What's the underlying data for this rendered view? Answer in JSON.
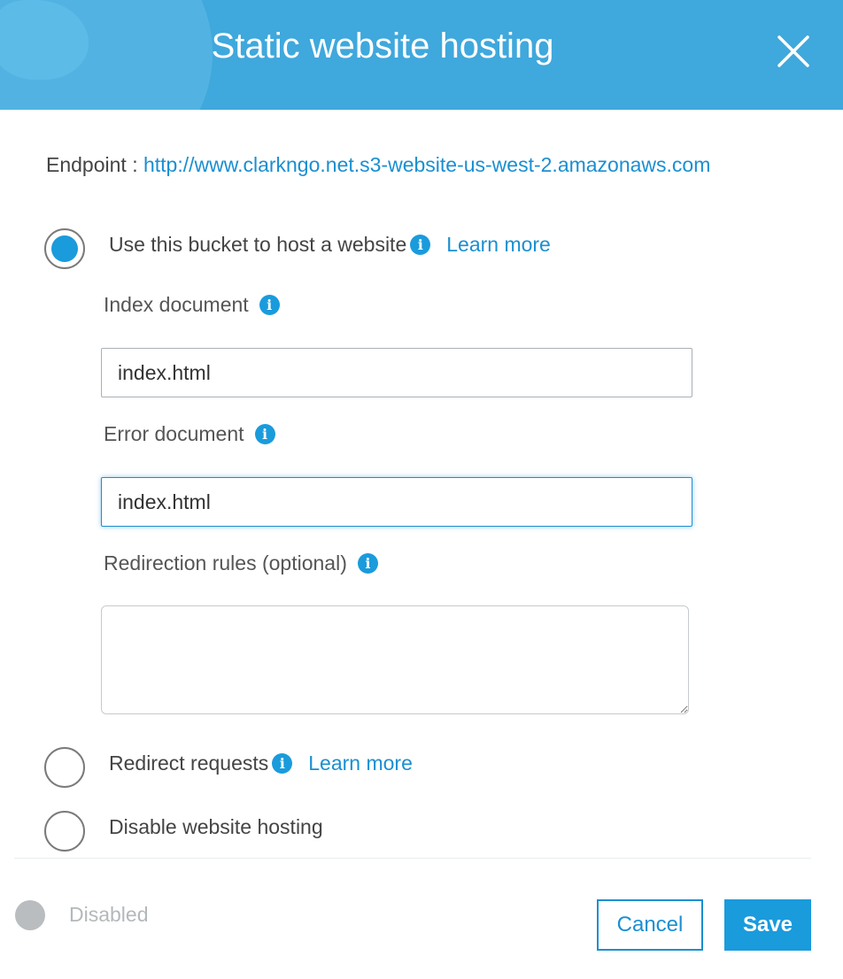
{
  "dialog": {
    "title": "Static website hosting",
    "close_icon": "close-icon"
  },
  "endpoint": {
    "label": "Endpoint : ",
    "url": "http://www.clarkngo.net.s3-website-us-west-2.amazonaws.com"
  },
  "options": {
    "host_website": {
      "label": "Use this bucket to host a website",
      "learn_more": "Learn more",
      "selected": true
    },
    "redirect": {
      "label": "Redirect requests",
      "learn_more": "Learn more",
      "selected": false
    },
    "disable": {
      "label": "Disable website hosting",
      "selected": false
    }
  },
  "fields": {
    "index_document": {
      "label": "Index document",
      "value": "index.html"
    },
    "error_document": {
      "label": "Error document",
      "value": "index.html"
    },
    "redirection_rules": {
      "label": "Redirection rules (optional)",
      "value": ""
    }
  },
  "status": {
    "label": "Disabled"
  },
  "buttons": {
    "cancel": "Cancel",
    "save": "Save"
  },
  "colors": {
    "header": "#3fa8dc",
    "accent": "#1a9bdc",
    "link": "#1a8fd1"
  },
  "icons": {
    "info": "info-icon",
    "close": "close-icon"
  }
}
